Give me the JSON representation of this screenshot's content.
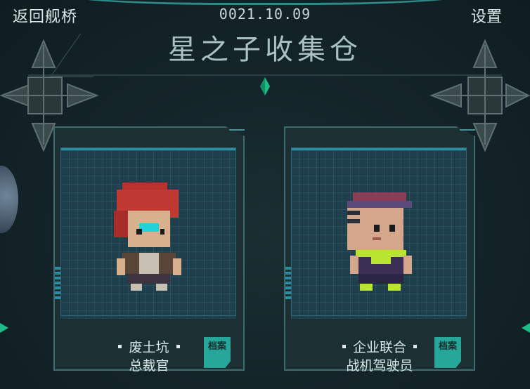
{
  "header": {
    "back_label": "返回舰桥",
    "date": "0021.10.09",
    "settings_label": "设置",
    "title": "星之子收集仓"
  },
  "cards": [
    {
      "name_line1": "废土坑",
      "name_line2": "总裁官",
      "archive_label": "档案"
    },
    {
      "name_line1": "企业联合",
      "name_line2": "战机驾驶员",
      "archive_label": "档案"
    }
  ],
  "colors": {
    "accent": "#27a69a",
    "frame": "#3f6a6e",
    "portrait_bg": "#1f3f4c",
    "gem": "#1cbd86"
  },
  "icons": [
    "back-arrow",
    "gear",
    "green-gem-icon",
    "archive-icon"
  ]
}
